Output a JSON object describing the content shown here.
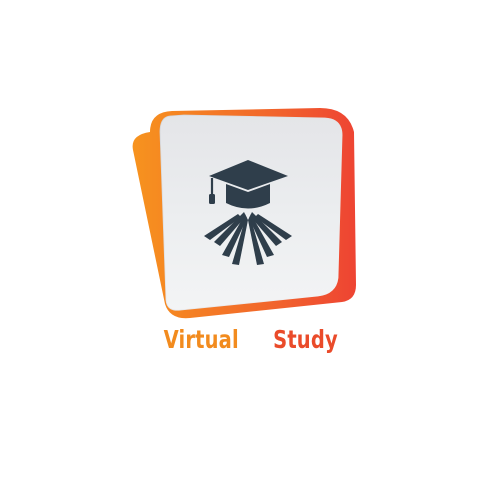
{
  "brand": {
    "word_1": "Virtual",
    "word_2": "Study",
    "colors": {
      "orange": "#f7931e",
      "red": "#ee4433",
      "panel_light": "#f1f2f4",
      "panel_shade": "#d5d7db",
      "emblem": "#2f3e4b",
      "word_1": "#f28b1e",
      "word_2": "#ea4b2a"
    },
    "emblem_icon": "graduation-cap-with-open-book-icon"
  }
}
